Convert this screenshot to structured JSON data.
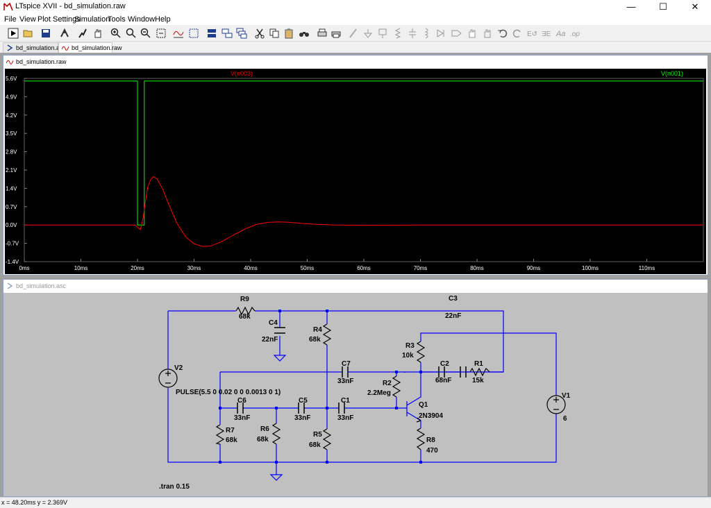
{
  "window": {
    "title": "LTspice XVII - bd_simulation.raw",
    "minimize": "—",
    "maximize": "☐",
    "close": "✕"
  },
  "menu": [
    "File",
    "View",
    "Plot Settings",
    "Simulation",
    "Tools",
    "Window",
    "Help"
  ],
  "toolbar_icons": [
    "run-icon",
    "open-icon",
    "save-icon",
    "control-panel-icon",
    "probe-icon",
    "pan-hand-icon",
    "zoom-in-icon",
    "zoom-area-icon",
    "zoom-out-icon",
    "zoom-fit-icon",
    "autorange-icon",
    "grid-icon",
    "tile-horizontal-icon",
    "tile-vertical-icon",
    "cascade-icon",
    "cut-icon",
    "copy-icon",
    "paste-icon",
    "find-icon",
    "print-setup-icon",
    "print-icon",
    "wire-icon",
    "ground-icon",
    "label-icon",
    "resistor-icon",
    "capacitor-icon",
    "inductor-icon",
    "diode-icon",
    "component-icon",
    "move-icon",
    "drag-icon",
    "undo-icon",
    "redo-icon",
    "rotate-icon",
    "mirror-icon",
    "text-icon",
    "spice-directive-icon"
  ],
  "tabs": [
    {
      "label": "bd_simulation.asc",
      "icon": "schematic-icon",
      "active": false
    },
    {
      "label": "bd_simulation.raw",
      "icon": "waveform-icon",
      "active": true
    }
  ],
  "waveform_window": {
    "title": "bd_simulation.raw"
  },
  "schematic_window": {
    "title": "bd_simulation.asc"
  },
  "chart_data": {
    "type": "line",
    "title": "",
    "xlabel": "",
    "ylabel": "",
    "background": "#000000",
    "grid": false,
    "x_ticks": [
      "0ms",
      "10ms",
      "20ms",
      "30ms",
      "40ms",
      "50ms",
      "60ms",
      "70ms",
      "80ms",
      "90ms",
      "100ms",
      "110ms"
    ],
    "y_ticks": [
      "5.6V",
      "4.9V",
      "4.2V",
      "3.5V",
      "2.8V",
      "2.1V",
      "1.4V",
      "0.7V",
      "0.0V",
      "-0.7V",
      "-1.4V"
    ],
    "xlim": [
      0,
      120
    ],
    "ylim": [
      -1.4,
      5.6
    ],
    "x_unit": "ms",
    "series": [
      {
        "name": "V(n003)",
        "color": "#ff0000",
        "x": [
          0,
          19.6,
          20.5,
          21,
          21.4,
          21.8,
          22.3,
          22.8,
          23.5,
          24.5,
          25.5,
          27,
          28.5,
          30,
          31.5,
          33,
          35,
          37,
          39,
          41,
          43,
          45,
          47,
          49,
          52,
          55,
          60,
          70,
          80,
          90,
          100,
          110,
          120
        ],
        "y": [
          0,
          0,
          -0.18,
          0.25,
          0.9,
          1.45,
          1.72,
          1.85,
          1.75,
          1.35,
          0.8,
          0.05,
          -0.45,
          -0.72,
          -0.82,
          -0.8,
          -0.62,
          -0.38,
          -0.15,
          0.02,
          0.1,
          0.12,
          0.1,
          0.06,
          0.02,
          0.0,
          -0.01,
          0,
          0,
          0,
          0,
          0,
          0
        ]
      },
      {
        "name": "V(n001)",
        "color": "#00ff00",
        "x": [
          0,
          20.0,
          20.0,
          21.2,
          21.2,
          120
        ],
        "y": [
          5.5,
          5.5,
          0,
          0,
          5.5,
          5.5
        ]
      }
    ]
  },
  "schematic": {
    "labels": {
      "R9": "R9",
      "R9v": "68k",
      "C4": "C4",
      "C4v": "22nF",
      "R4": "R4",
      "R4v": "68k",
      "C3": "C3",
      "C3v": "22nF",
      "R3": "R3",
      "R3v": "10k",
      "C2": "C2",
      "C2v": "68nF",
      "R1": "R1",
      "R1v": "15k",
      "V2": "V2",
      "V2v": "PULSE(5.5 0 0.02 0 0 0.0013 0 1)",
      "C7": "C7",
      "C7v": "33nF",
      "R2": "R2",
      "R2v": "2.2Meg",
      "Q1": "Q1",
      "Q1v": "2N3904",
      "V1": "V1",
      "V1v": "6",
      "C6": "C6",
      "C6v": "33nF",
      "C5": "C5",
      "C5v": "33nF",
      "C1": "C1",
      "C1v": "33nF",
      "R7": "R7",
      "R7v": "68k",
      "R6": "R6",
      "R6v": "68k",
      "R5": "R5",
      "R5v": "68k",
      "R8": "R8",
      "R8v": "470",
      "directive": ".tran 0.15"
    }
  },
  "status": {
    "text": "x = 48.20ms   y = 2.369V"
  }
}
